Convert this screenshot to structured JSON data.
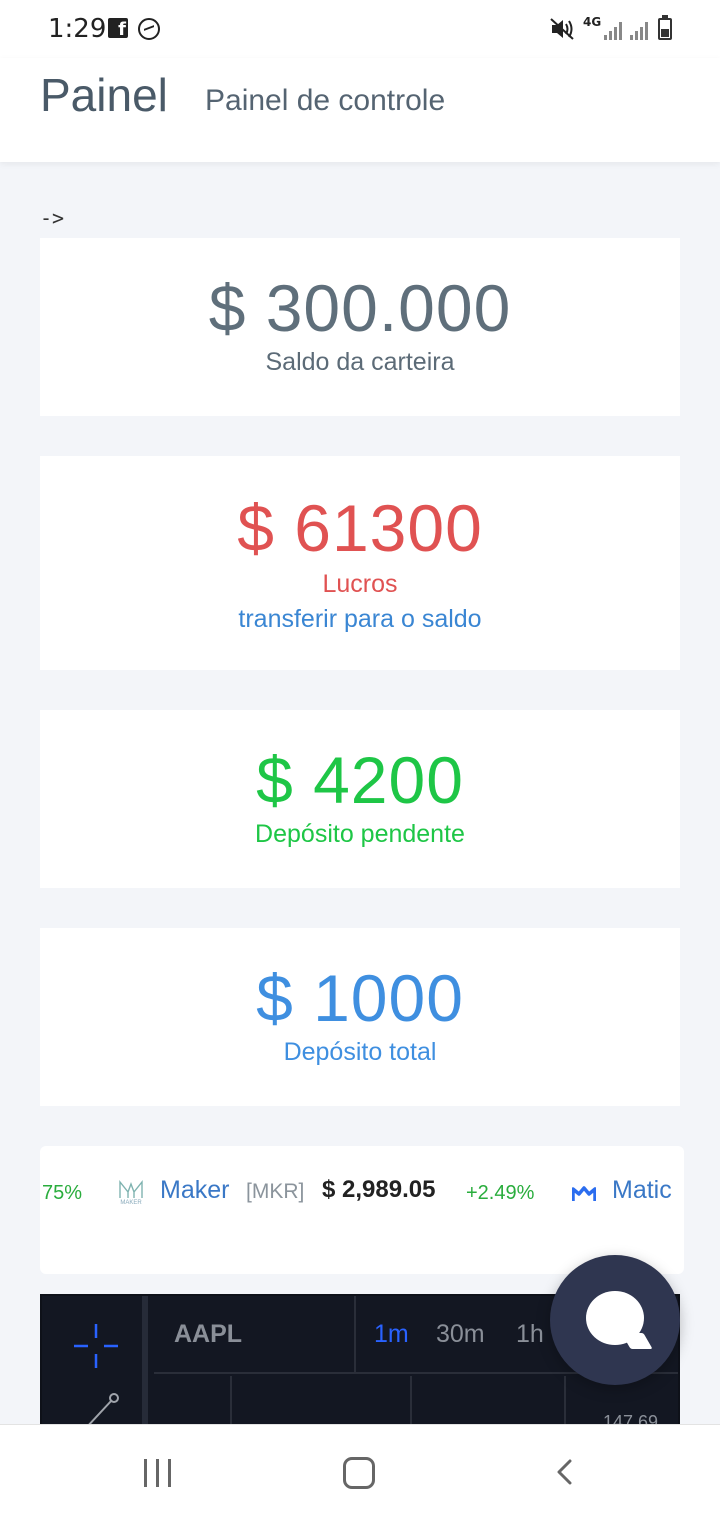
{
  "status_bar": {
    "time": "1:29",
    "network": "4G"
  },
  "header": {
    "title": "Painel",
    "subtitle": "Painel de controle"
  },
  "arrow_text": "->",
  "cards": [
    {
      "amount": "$ 300.000",
      "label": "Saldo da carteira"
    },
    {
      "amount": "$ 61300",
      "label": "Lucros",
      "link": "transferir para o saldo"
    },
    {
      "amount": "$ 4200",
      "label": "Depósito pendente"
    },
    {
      "amount": "$ 1000",
      "label": "Depósito total"
    }
  ],
  "ticker": {
    "prev_change": "75%",
    "maker": {
      "name": "Maker",
      "symbol": "[MKR]",
      "price": "$ 2,989.05",
      "change": "+2.49%",
      "logo_text": "MAKER"
    },
    "next": {
      "name": "Matic"
    }
  },
  "chart_widget": {
    "symbol": "AAPL",
    "timeframes": [
      "1m",
      "30m",
      "1h"
    ],
    "active_timeframe": "1m",
    "price_partial": "147.69"
  },
  "colors": {
    "balance": "#5f6f7b",
    "profit": "#e05252",
    "pending": "#1ec646",
    "total": "#3f8fe0",
    "link": "#3a86d3",
    "chat_fab": "#2f3650"
  }
}
